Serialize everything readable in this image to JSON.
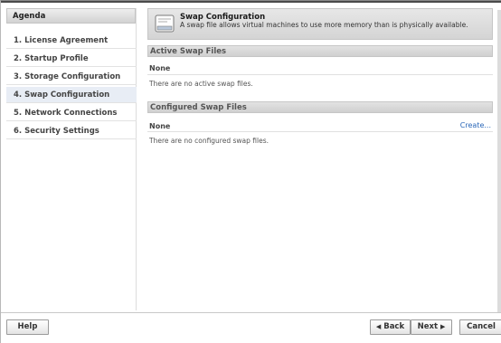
{
  "sidebar": {
    "header": "Agenda",
    "items": [
      {
        "label": "1. License Agreement"
      },
      {
        "label": "2. Startup Profile"
      },
      {
        "label": "3. Storage Configuration"
      },
      {
        "label": "4. Swap Configuration",
        "active": true
      },
      {
        "label": "5. Network Connections"
      },
      {
        "label": "6. Security Settings"
      }
    ]
  },
  "banner": {
    "title": "Swap Configuration",
    "description": "A swap file allows virtual machines to use more memory than is physically available.",
    "icon": "swap-file-icon"
  },
  "active_section": {
    "header": "Active Swap Files",
    "label": "None",
    "empty_text": "There are no active swap files."
  },
  "configured_section": {
    "header": "Configured Swap Files",
    "label": "None",
    "create_link": "Create...",
    "empty_text": "There are no configured swap files."
  },
  "footer": {
    "help": "Help",
    "back": "Back",
    "next": "Next",
    "cancel": "Cancel",
    "back_icon": "◀",
    "next_icon": "▶"
  },
  "colors": {
    "link": "#2a67b8",
    "header_gradient_top": "#e7e7e7",
    "header_gradient_bottom": "#d4d4d4"
  }
}
